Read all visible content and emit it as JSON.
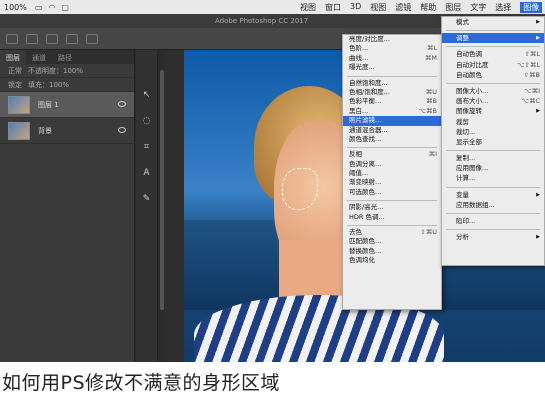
{
  "menubar": {
    "zoom": "100%",
    "items": [
      "视图",
      "窗口",
      "3D",
      "视图",
      "滤镜",
      "帮助",
      "图层",
      "文字",
      "选择",
      "图像"
    ],
    "active_index": 9
  },
  "app": {
    "title": "Adobe Photoshop CC 2017"
  },
  "layers_panel": {
    "tabs": [
      "图层",
      "通道",
      "路径"
    ],
    "mode_label": "正常",
    "opacity_label": "不透明度：100%",
    "fill_label": "填充：100%",
    "lock_label": "锁定",
    "layers": [
      {
        "name": "图层 1",
        "selected": true
      },
      {
        "name": "背景",
        "selected": false
      }
    ]
  },
  "image_menu": {
    "items": [
      {
        "label": "亮度/对比度...",
        "shortcut": ""
      },
      {
        "label": "色阶...",
        "shortcut": "⌘L"
      },
      {
        "label": "曲线...",
        "shortcut": "⌘M"
      },
      {
        "label": "曝光度...",
        "shortcut": ""
      },
      {
        "sep": true
      },
      {
        "label": "自然饱和度...",
        "shortcut": ""
      },
      {
        "label": "色相/饱和度...",
        "shortcut": "⌘U"
      },
      {
        "label": "色彩平衡...",
        "shortcut": "⌘B"
      },
      {
        "label": "黑白...",
        "shortcut": "⌥⌘B"
      },
      {
        "label": "照片滤镜...",
        "shortcut": "",
        "highlighted": true
      },
      {
        "label": "通道混合器...",
        "shortcut": ""
      },
      {
        "label": "颜色查找...",
        "shortcut": ""
      },
      {
        "sep": true
      },
      {
        "label": "反相",
        "shortcut": "⌘I"
      },
      {
        "label": "色调分离...",
        "shortcut": ""
      },
      {
        "label": "阈值...",
        "shortcut": ""
      },
      {
        "label": "渐变映射...",
        "shortcut": ""
      },
      {
        "label": "可选颜色...",
        "shortcut": ""
      },
      {
        "sep": true
      },
      {
        "label": "阴影/高光...",
        "shortcut": ""
      },
      {
        "label": "HDR 色调...",
        "shortcut": ""
      },
      {
        "sep": true
      },
      {
        "label": "去色",
        "shortcut": "⇧⌘U"
      },
      {
        "label": "匹配颜色...",
        "shortcut": ""
      },
      {
        "label": "替换颜色...",
        "shortcut": ""
      },
      {
        "label": "色调均化",
        "shortcut": ""
      }
    ]
  },
  "main_menu": {
    "items": [
      {
        "label": "模式",
        "shortcut": "",
        "arrow": true
      },
      {
        "sep": true
      },
      {
        "label": "调整",
        "shortcut": "",
        "arrow": true,
        "highlighted": true
      },
      {
        "sep": true
      },
      {
        "label": "自动色调",
        "shortcut": "⇧⌘L"
      },
      {
        "label": "自动对比度",
        "shortcut": "⌥⇧⌘L"
      },
      {
        "label": "自动颜色",
        "shortcut": "⇧⌘B"
      },
      {
        "sep": true
      },
      {
        "label": "图像大小...",
        "shortcut": "⌥⌘I"
      },
      {
        "label": "画布大小...",
        "shortcut": "⌥⌘C"
      },
      {
        "label": "图像旋转",
        "shortcut": "",
        "arrow": true
      },
      {
        "label": "裁剪",
        "shortcut": ""
      },
      {
        "label": "裁切...",
        "shortcut": ""
      },
      {
        "label": "显示全部",
        "shortcut": ""
      },
      {
        "sep": true
      },
      {
        "label": "复制...",
        "shortcut": ""
      },
      {
        "label": "应用图像...",
        "shortcut": ""
      },
      {
        "label": "计算...",
        "shortcut": ""
      },
      {
        "sep": true
      },
      {
        "label": "变量",
        "shortcut": "",
        "arrow": true
      },
      {
        "label": "应用数据组...",
        "shortcut": ""
      },
      {
        "sep": true
      },
      {
        "label": "陷印...",
        "shortcut": ""
      },
      {
        "sep": true
      },
      {
        "label": "分析",
        "shortcut": "",
        "arrow": true
      }
    ]
  },
  "caption": "如何用PS修改不满意的身形区域"
}
